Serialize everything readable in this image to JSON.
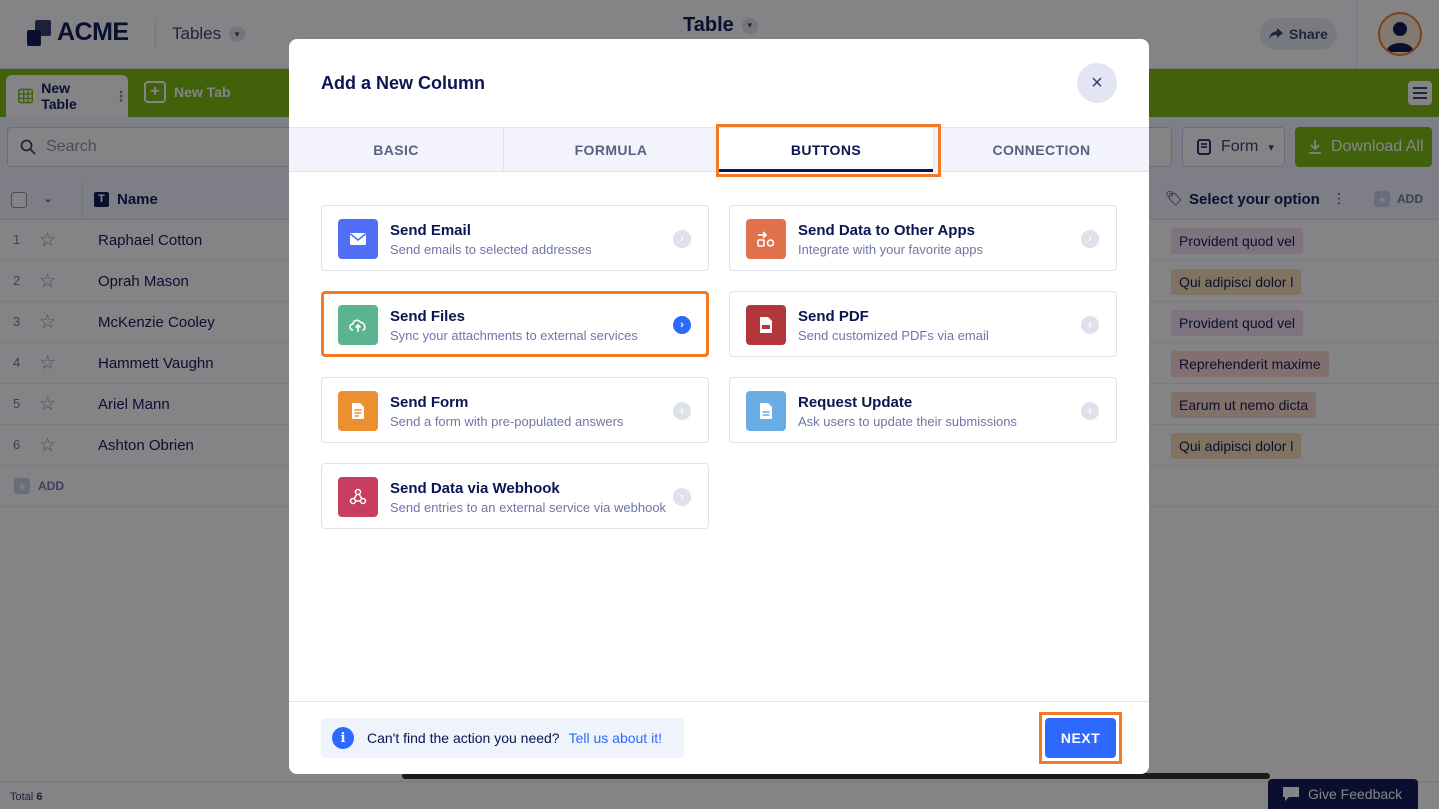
{
  "app": {
    "logo_text": "ACME",
    "tables_menu": "Tables",
    "title": "Table",
    "share_label": "Share"
  },
  "tabs": {
    "active_label": "New Table",
    "new_tab_label": "New Tab"
  },
  "toolbar": {
    "search_placeholder": "Search",
    "form_label": "Form",
    "download_label": "Download All"
  },
  "grid": {
    "columns": [
      "Name",
      "Select your option"
    ],
    "add_column_label": "ADD",
    "rows": [
      {
        "num": "1",
        "name": "Raphael Cotton",
        "option": "Provident quod vel",
        "option_color": "#f3dcf0"
      },
      {
        "num": "2",
        "name": "Oprah Mason",
        "option": "Qui adipisci dolor l",
        "option_color": "#f6dcb6"
      },
      {
        "num": "3",
        "name": "McKenzie Cooley",
        "option": "Provident quod vel",
        "option_color": "#f3dcf0"
      },
      {
        "num": "4",
        "name": "Hammett Vaughn",
        "option": "Reprehenderit maxime",
        "option_color": "#fbd5cf"
      },
      {
        "num": "5",
        "name": "Ariel Mann",
        "option": "Earum ut nemo dicta",
        "option_color": "#fbd9c9"
      },
      {
        "num": "6",
        "name": "Ashton Obrien",
        "option": "Qui adipisci dolor l",
        "option_color": "#f6dcb6"
      }
    ],
    "add_row_label": "ADD"
  },
  "footer": {
    "total_label": "Total",
    "total_count": "6",
    "feedback_label": "Give Feedback"
  },
  "modal": {
    "title": "Add a New Column",
    "tabs": [
      "BASIC",
      "FORMULA",
      "BUTTONS",
      "CONNECTION"
    ],
    "active_tab": "BUTTONS",
    "options": [
      {
        "title": "Send Email",
        "desc": "Send emails to selected addresses",
        "icon": "mail-icon",
        "color": "#4f6ef5"
      },
      {
        "title": "Send Data to Other Apps",
        "desc": "Integrate with your favorite apps",
        "icon": "integration-icon",
        "color": "#e0714a"
      },
      {
        "title": "Send Files",
        "desc": "Sync your attachments to external services",
        "icon": "cloud-upload-icon",
        "color": "#5bb38f"
      },
      {
        "title": "Send PDF",
        "desc": "Send customized PDFs via email",
        "icon": "pdf-icon",
        "color": "#b3363d"
      },
      {
        "title": "Send Form",
        "desc": "Send a form with pre-populated answers",
        "icon": "form-icon",
        "color": "#eb8f30"
      },
      {
        "title": "Request Update",
        "desc": "Ask users to update their submissions",
        "icon": "document-icon",
        "color": "#6aade4"
      },
      {
        "title": "Send Data via Webhook",
        "desc": "Send entries to an external service via webhook",
        "icon": "webhook-icon",
        "color": "#c73e5f"
      }
    ],
    "selected_option": "Send Files",
    "help_text": "Can't find the action you need?",
    "help_link": "Tell us about it!",
    "next_label": "NEXT"
  }
}
